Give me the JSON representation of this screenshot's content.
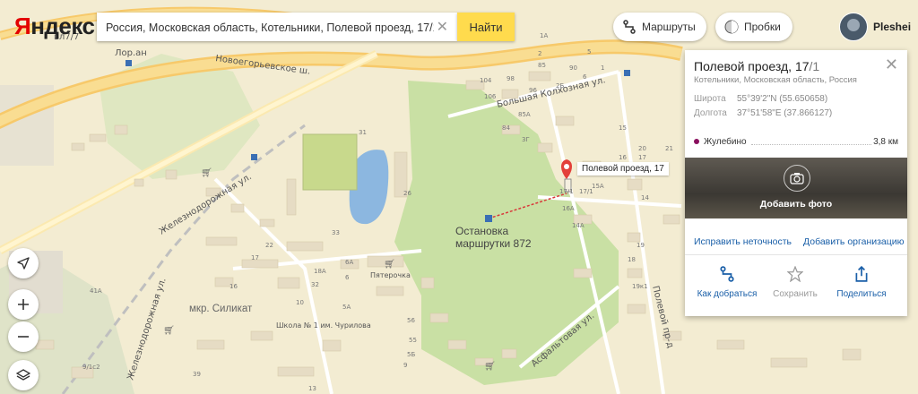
{
  "header": {
    "logo": "Яндекс",
    "search_value": "Россия, Московская область, Котельники, Полевой проезд, 17/1",
    "search_button": "Найти",
    "routes_button": "Маршруты",
    "traffic_button": "Пробки",
    "user_name": "Pleshei"
  },
  "map": {
    "streets": {
      "novoegor": "Новоегорьевское ш.",
      "zheleznodorozhnaya1": "Железнодорожная ул.",
      "zheleznodorozhnaya2": "Железнодорожная ул.",
      "bolshaya_kolkhoznaya": "Большая Колхозная ул.",
      "polevoy": "Полевой пр-д",
      "asfaltovaya": "Асфальтовая ул.",
      "lecha": "Лор.ан",
      "vlg": "вл7/7"
    },
    "pin_label": "Полевой проезд, 17",
    "pin_house": "17/1",
    "stop_label_line1": "Остановка",
    "stop_label_line2": "маршрутки 872",
    "district": "мкр. Силикат",
    "poi_pyaterochka": "Пятерочка",
    "poi_school": "Школа № 1 им. Чурилова",
    "house_numbers": [
      "104",
      "98",
      "106",
      "96",
      "90",
      "85",
      "85А",
      "84",
      "3Г",
      "2Б",
      "1А",
      "2",
      "5",
      "6",
      "1",
      "15",
      "16",
      "17",
      "20",
      "2А",
      "14",
      "15А",
      "16А",
      "14А",
      "19",
      "19к1",
      "18",
      "21",
      "31",
      "26",
      "33",
      "32",
      "22",
      "10",
      "18А",
      "17",
      "16",
      "6А",
      "6",
      "5А",
      "56",
      "55",
      "5Б",
      "9",
      "41А",
      "39",
      "9/1с2",
      "13"
    ]
  },
  "card": {
    "title": "Полевой проезд, 17",
    "title_suffix": "/1",
    "subtitle": "Котельники, Московская область, Россия",
    "lat_label": "Широта",
    "lat_value": "55°39'2\"N (55.650658)",
    "lon_label": "Долгота",
    "lon_value": "37°51'58\"E (37.866127)",
    "metro_name": "Жулебино",
    "metro_distance": "3,8 км",
    "metro_color": "#8a0f5e",
    "add_photo": "Добавить фото",
    "fix_link": "Исправить неточность",
    "add_org_link": "Добавить организацию",
    "action_route": "Как добраться",
    "action_save": "Сохранить",
    "action_share": "Поделиться"
  },
  "colors": {
    "accent": "#ffdb4d",
    "link": "#1a5fa8",
    "pin": "#e3403a"
  }
}
